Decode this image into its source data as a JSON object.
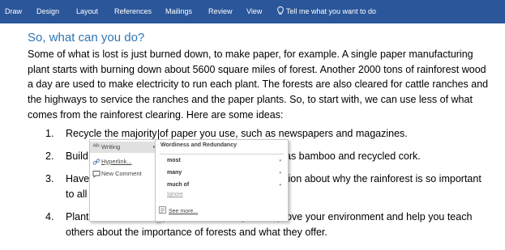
{
  "ribbon": {
    "tabs": [
      "Draw",
      "Design",
      "Layout",
      "References",
      "Mailings",
      "Review",
      "View"
    ],
    "tell_me": "Tell me what you want to do",
    "bg_color": "#2b579a"
  },
  "document": {
    "heading": "So, what can you do?",
    "heading_color": "#2e74b5",
    "paragraph_lines": [
      "Some of what is lost is just burned down, to make paper, for example. A single paper manufacturing",
      "plant starts with burning down about 5600 square miles of forest. Another 2000 tons of rainforest wood",
      "a day are used to make electricity to run each plant. The forests are also cleared for cattle ranches and",
      "the highways to service the ranches and the paper plants. So, to start with, we can use less of what",
      "comes from the rainforest clearing. Here are some ideas:"
    ],
    "list": [
      {
        "num": "1.",
        "line1_a": "Recycle the majority",
        "line1_b": " of paper you use, such as newspapers and magazines."
      },
      {
        "num": "2.",
        "line1_a": "Build",
        "line1_b": "as bamboo and recycled cork."
      },
      {
        "num": "3.",
        "line1_a": "Have a rainforest th",
        "line1_b": "tion about why the rainforest is so important",
        "line2": "to all of us. Who doe"
      },
      {
        "num": "4.",
        "line1_a": "Plant more trees and protect them. They will improve your environment and help you teach",
        "line2": "others about the importance of forests and what they offer."
      }
    ]
  },
  "context_menu": {
    "items": [
      {
        "label": "Writing",
        "icon": "spelling-icon",
        "highlighted": true
      },
      {
        "label": "Hyperlink...",
        "icon": "hyperlink-icon"
      },
      {
        "label": "New Comment",
        "icon": "comment-icon"
      }
    ]
  },
  "writing_submenu": {
    "heading": "Wordiness and Redundancy",
    "suggestions": [
      "most",
      "many",
      "much of"
    ],
    "ignore": "Ignore",
    "see_more": "See more..."
  }
}
